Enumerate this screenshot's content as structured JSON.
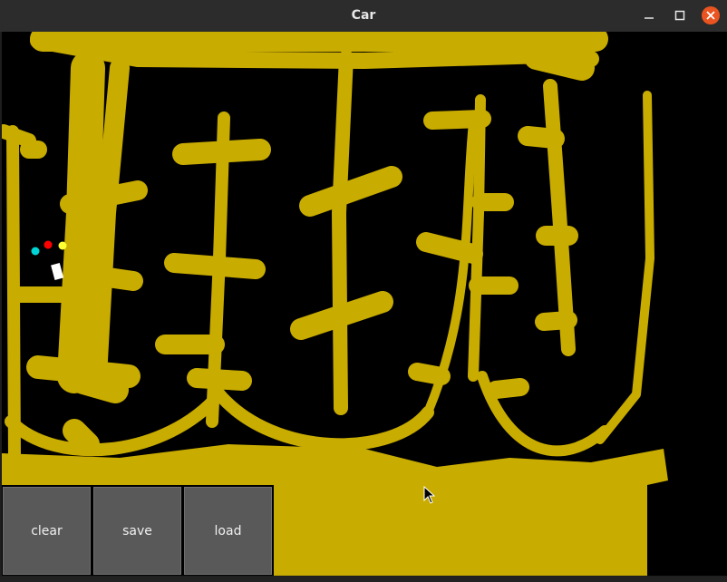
{
  "window": {
    "title": "Car",
    "controls": {
      "minimize_icon": "minimize-icon",
      "maximize_icon": "maximize-icon",
      "close_icon": "close-icon"
    },
    "close_color": "#e95420"
  },
  "canvas": {
    "background": "#000000",
    "sand_color": "#c9ac00",
    "car": {
      "body_color": "#ffffff",
      "sensors": [
        {
          "name": "sensor-left",
          "color": "#00d4d4"
        },
        {
          "name": "sensor-center",
          "color": "#ff0000"
        },
        {
          "name": "sensor-right",
          "color": "#ffff33"
        }
      ]
    }
  },
  "buttons": {
    "clear": "clear",
    "save": "save",
    "load": "load"
  }
}
